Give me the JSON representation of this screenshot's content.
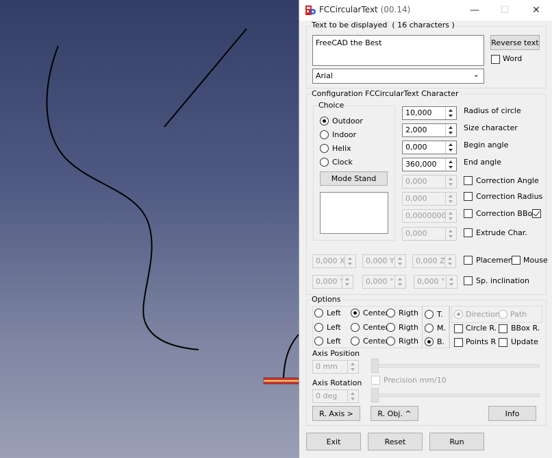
{
  "window": {
    "title": "FCCircularText",
    "version": "(00.14)"
  },
  "text_group": {
    "label_prefix": "Text to be displayed",
    "char_count": "( 16 characters )",
    "text_value": "FreeCAD the Best",
    "reverse_button": "Reverse text",
    "word_label": "Word",
    "font_value": "Arial"
  },
  "config_group": {
    "title": "Configuration FCCircularText Character",
    "choice_title": "Choice",
    "choices": [
      "Outdoor",
      "Indoor",
      "Helix",
      "Clock"
    ],
    "mode_stand_button": "Mode Stand",
    "params": [
      {
        "value": "10,000",
        "label": "Radius of circle"
      },
      {
        "value": "2,000",
        "label": "Size character"
      },
      {
        "value": "0,000",
        "label": "Begin angle"
      },
      {
        "value": "360,000",
        "label": "End angle"
      }
    ],
    "corrections": [
      {
        "value": "0,000",
        "label": "Correction Angle"
      },
      {
        "value": "0,000",
        "label": "Correction Radius"
      },
      {
        "value": "0,0000000",
        "label": "Correction BBox"
      },
      {
        "value": "0,000",
        "label": "Extrude Char."
      }
    ],
    "placement": {
      "x": "0,000 X",
      "y": "0,000 Y",
      "z": "0,000 Z",
      "label": "Placement",
      "mouse_label": "Mouse"
    },
    "inclination": {
      "a": "0,000 °",
      "b": "0,000 °",
      "c": "0,000 °",
      "label": "Sp. inclination"
    }
  },
  "options_group": {
    "title": "Options",
    "align_rows": [
      [
        "Left",
        "Center",
        "Rigth"
      ],
      [
        "Left",
        "Center",
        "Rigth"
      ],
      [
        "Left",
        "Center",
        "Rigth"
      ]
    ],
    "tmb": [
      "T.",
      "M.",
      "B."
    ],
    "direction_label": "Direction",
    "path_label": "Path",
    "circle_r": "Circle R.",
    "bbox_r": "BBox R.",
    "points_r": "Points R",
    "update": "Update",
    "axis_position_label": "Axis Position",
    "axis_position_value": "0 mm",
    "precision_label": "Precision mm/10",
    "axis_rotation_label": "Axis Rotation",
    "axis_rotation_value": "0 deg",
    "r_axis_button": "R. Axis >",
    "r_obj_button": "R. Obj. ^",
    "info_button": "Info"
  },
  "footer": {
    "exit": "Exit",
    "reset": "Reset",
    "run": "Run"
  }
}
